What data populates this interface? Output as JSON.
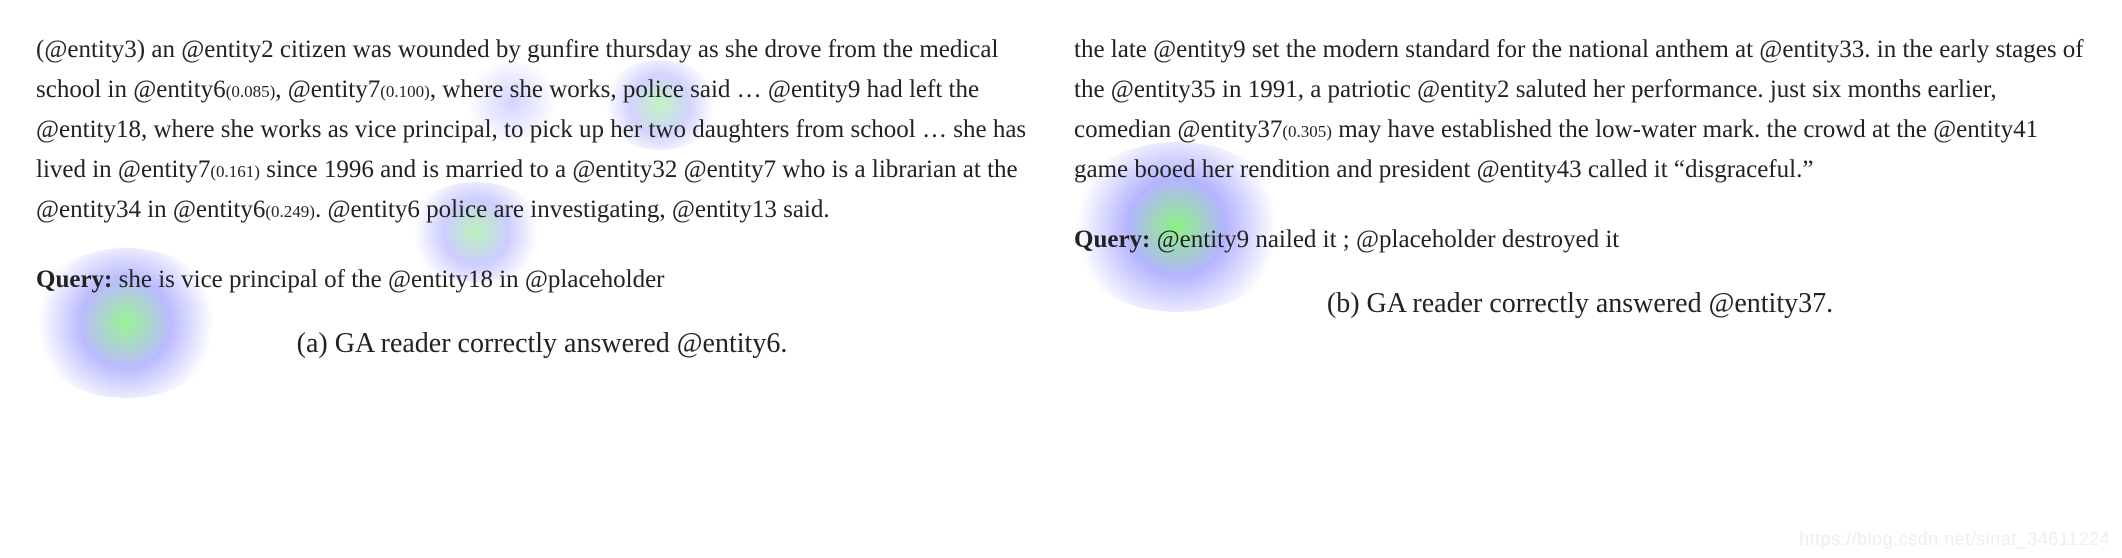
{
  "left": {
    "passage_parts": {
      "p0": "(@entity3) an @entity2 citizen was wounded by gunfire thursday as she drove from the medical school in @entity6",
      "a1": "(0.085)",
      "p1": ", @entity7",
      "a2": "(0.100)",
      "p2": ", where she works, police said … @entity9 had left the @entity18, where she works as vice principal, to pick up her two daughters from school … she has lived in @entity7",
      "a3": "(0.161)",
      "p3": " since 1996 and is married to a @entity32 @entity7 who is a librarian at the @entity34 in @entity6",
      "a4": "(0.249)",
      "p4": ". @entity6 police are investigating, @entity13 said."
    },
    "query_label": "Query:",
    "query_text": " she is vice principal of the @entity18 in @placeholder",
    "caption": "(a) GA reader correctly answered @entity6."
  },
  "right": {
    "passage_parts": {
      "p0": "the late @entity9 set the modern standard for the national anthem at @entity33. in the early stages of the @entity35 in 1991, a patriotic @entity2 saluted her performance. just six months earlier, comedian @entity37",
      "a1": "(0.305)",
      "p1": " may have established the low-water mark. the crowd at the @entity41 game booed her rendition and president @entity43 called it “disgraceful.”"
    },
    "query_label": "Query:",
    "query_text": " @entity9 nailed it ; @placeholder destroyed it",
    "caption": "(b) GA reader correctly answered @entity37."
  },
  "attention_values": {
    "left_entity6_a": 0.085,
    "left_entity7_a": 0.1,
    "left_entity7_b": 0.161,
    "left_entity6_b": 0.249,
    "right_entity37": 0.305
  },
  "watermark": "https://blog.csdn.net/sinat_34611224"
}
